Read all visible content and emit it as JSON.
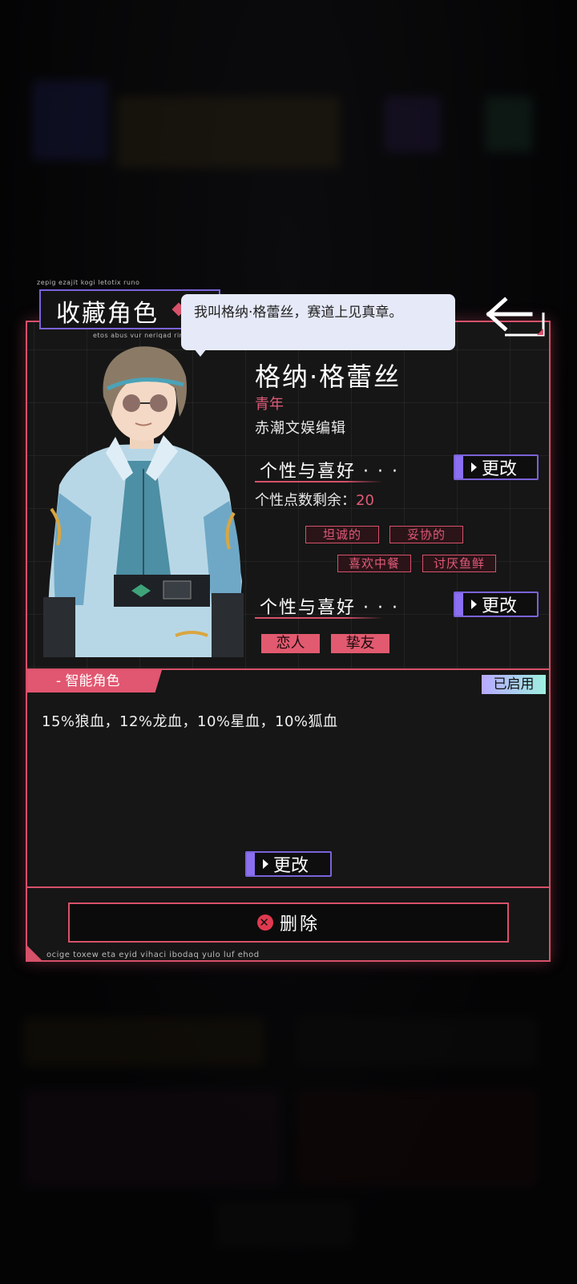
{
  "title": "收藏角色",
  "decor_text_top": "zepig ezajit kogi letotix runo",
  "decor_text_sub": "etos abus vur neriqad rim",
  "decor_text_bottom": "ocige toxew eta eyid vihaci ibodaq yulo luf ehod",
  "speech": "我叫格纳·格蕾丝，赛道上见真章。",
  "character": {
    "name": "格纳·格蕾丝",
    "age_group": "青年",
    "occupation": "赤潮文娱编辑"
  },
  "personality": {
    "heading": "个性与喜好 · · ·",
    "change_label": "更改",
    "points_label": "个性点数剩余：",
    "points_value": "20",
    "traits": [
      "坦诚的",
      "妥协的",
      "喜欢中餐",
      "讨厌鱼鲜"
    ]
  },
  "relationships": {
    "heading": "个性与喜好 · · ·",
    "change_label": "更改",
    "items": [
      "恋人",
      "挚友"
    ]
  },
  "smart_role": {
    "label": "- 智能角色",
    "status": "已启用",
    "description": "15%狼血，12%龙血，10%星血，10%狐血",
    "change_label": "更改"
  },
  "delete_label": "删除",
  "icons": {
    "back": "back-arrow-icon",
    "delete": "close-circle-icon",
    "play": "play-triangle-icon"
  },
  "colors": {
    "accent_pink": "#d7516a",
    "accent_purple": "#7b63d8",
    "bubble": "#e6e9f7"
  }
}
